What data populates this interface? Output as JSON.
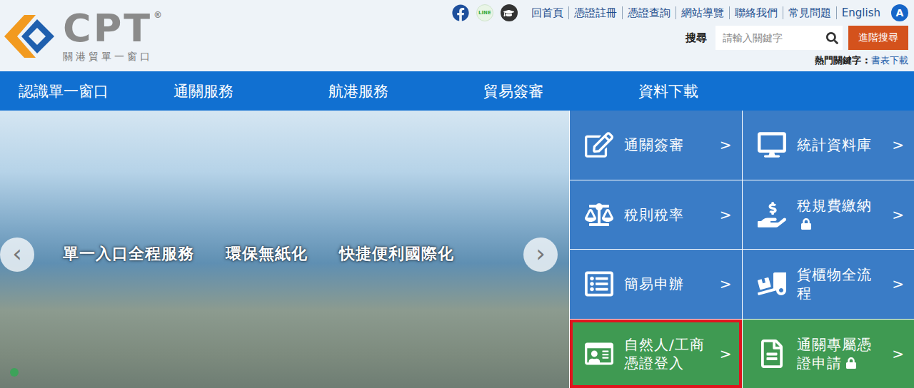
{
  "logo": {
    "letters": "CPT",
    "mark": "®",
    "subtitle": "關港貿單一窗口"
  },
  "social": {
    "line": "LINE"
  },
  "top_links": [
    "回首頁",
    "憑證註冊",
    "憑證查詢",
    "網站導覽",
    "聯絡我們",
    "常見問題",
    "English"
  ],
  "font_size_button": "A",
  "search": {
    "label": "搜尋",
    "placeholder": "請輸入關鍵字",
    "button": "進階搜尋"
  },
  "hot_keywords": {
    "label": "熱門關鍵字 :",
    "items": [
      "書表下載"
    ]
  },
  "nav": [
    "認識單一窗口",
    "通關服務",
    "航港服務",
    "貿易簽審",
    "資料下載"
  ],
  "slider": {
    "captions": [
      "單一入口全程服務",
      "環保無紙化",
      "快捷便利國際化"
    ],
    "prev": "‹",
    "next": "›",
    "dots": [
      {
        "selected": true
      }
    ]
  },
  "tiles": {
    "chevron": ">",
    "items": [
      {
        "label": "通關簽審",
        "locked": false,
        "selected": false,
        "color": "#3a7cc6"
      },
      {
        "label": "統計資料庫",
        "locked": false,
        "selected": false,
        "color": "#3a7cc6"
      },
      {
        "label": "稅則稅率",
        "locked": false,
        "selected": false,
        "color": "#3a7cc6"
      },
      {
        "label": "稅規費繳納",
        "locked": true,
        "selected": false,
        "color": "#3a7cc6"
      },
      {
        "label": "簡易申辦",
        "locked": false,
        "selected": false,
        "color": "#3a7cc6"
      },
      {
        "label": "貨櫃物全流程",
        "locked": false,
        "selected": false,
        "color": "#3a7cc6"
      },
      {
        "label": "自然人/工商憑證登入",
        "locked": false,
        "selected": true,
        "color": "#3f9a52"
      },
      {
        "label": "通關專屬憑證申請",
        "locked": true,
        "selected": false,
        "color": "#3f9a52"
      }
    ]
  }
}
